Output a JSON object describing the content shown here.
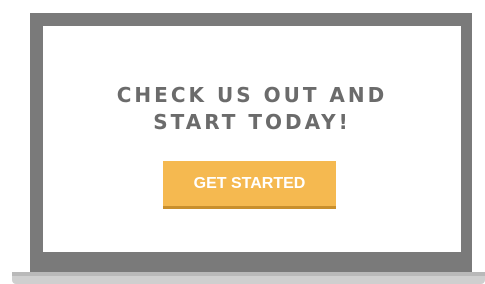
{
  "hero": {
    "headline_line1": "CHECK US OUT AND",
    "headline_line2": "START TODAY!",
    "cta_label": "GET STARTED"
  },
  "colors": {
    "frame": "#7a7a7a",
    "screen": "#ffffff",
    "headline": "#6b6b6b",
    "cta_background": "#f5b950",
    "cta_text": "#ffffff"
  }
}
